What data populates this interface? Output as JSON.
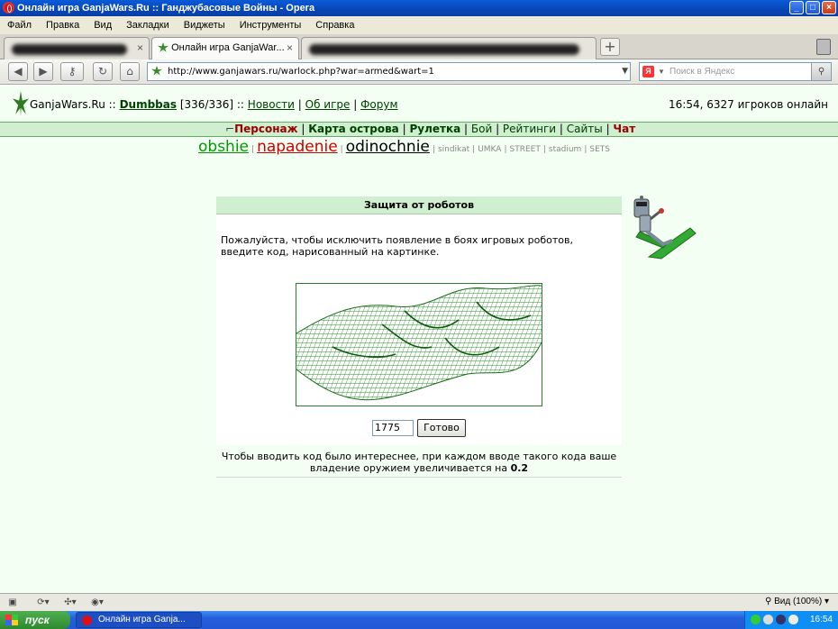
{
  "window": {
    "title": "Онлайн игра GanjaWars.Ru :: Ганджубасовые Войны - Opera"
  },
  "menu": [
    "Файл",
    "Правка",
    "Вид",
    "Закладки",
    "Виджеты",
    "Инструменты",
    "Справка"
  ],
  "tabs": {
    "active_label": "Онлайн игра GanjaWar..."
  },
  "address": {
    "url": "http://www.ganjawars.ru/warlock.php?war=armed&wart=1"
  },
  "search": {
    "placeholder": "Поиск в Яндекс"
  },
  "site": {
    "brand": "GanjaWars.Ru",
    "sep1": "::",
    "user": "Dumbbas",
    "hp": "[336/336]",
    "sep2": "::",
    "links": [
      "Новости",
      "Об игре",
      "Форум"
    ],
    "status": "16:54, 6327 игроков онлайн"
  },
  "nav": [
    "Персонаж",
    "Карта острова",
    "Рулетка",
    "Бой",
    "Рейтинги",
    "Сайты",
    "Чат"
  ],
  "subnav": {
    "big": [
      "obshie",
      "napadenie",
      "odinochnie"
    ],
    "small": [
      "sindikat",
      "UMKA",
      "STREET",
      "stadium",
      "SETS"
    ]
  },
  "captcha": {
    "title": "Защита от роботов",
    "text": "Пожалуйста, чтобы исключить появление в боях игровых роботов, введите код, нарисованный на картинке.",
    "code_value": "1775",
    "submit_label": "Готово",
    "footer_text": "Чтобы вводить код было интереснее, при каждом вводе такого кода ваше владение оружием увеличивается на",
    "footer_value": "0.2"
  },
  "statusbar": {
    "zoom": "Вид (100%)"
  },
  "taskbar": {
    "start": "пуск",
    "task": "Онлайн игра Ganja...",
    "clock": "16:54"
  }
}
